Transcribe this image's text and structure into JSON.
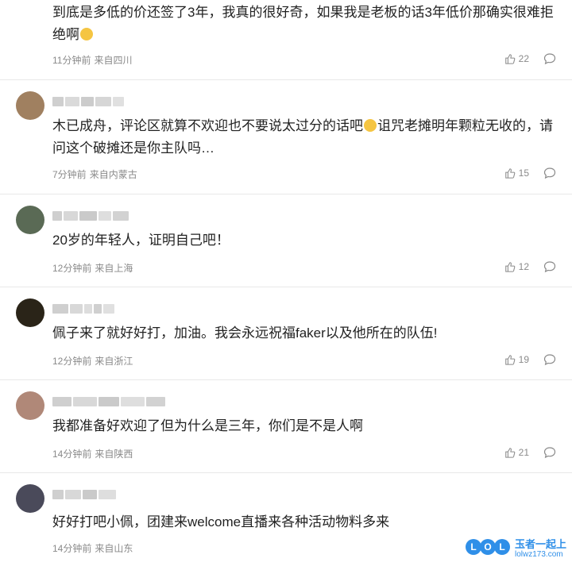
{
  "comments": [
    {
      "text": "到底是多低的价还签了3年，我真的很好奇，如果我是老板的话3年低价那确实很难拒绝啊",
      "emoji": "laugh-cry-emoji",
      "time": "11分钟前",
      "location": "来自四川",
      "likes": "22"
    },
    {
      "text": "木已成舟，评论区就算不欢迎也不要说太过分的话吧",
      "text2": "诅咒老摊明年颗粒无收的，请问这个破摊还是你主队吗…",
      "emoji": "laugh-cry-emoji",
      "time": "7分钟前",
      "location": "来自内蒙古",
      "likes": "15"
    },
    {
      "text": "20岁的年轻人，证明自己吧！",
      "time": "12分钟前",
      "location": "来自上海",
      "likes": "12"
    },
    {
      "text": "佩子来了就好好打，加油。我会永远祝福faker以及他所在的队伍!",
      "time": "12分钟前",
      "location": "来自浙江",
      "likes": "19"
    },
    {
      "text": "我都准备好欢迎了但为什么是三年，你们是不是人啊",
      "time": "14分钟前",
      "location": "来自陕西",
      "likes": "21"
    },
    {
      "text": "好好打吧小佩，团建来welcome直播来各种活动物料多来",
      "time": "14分钟前",
      "location": "来自山东",
      "likes": ""
    }
  ],
  "icons": {
    "like": "thumbs-up-icon",
    "reply": "comment-bubble-icon"
  },
  "watermark": {
    "logo": "LOL",
    "title": "玉者一起上",
    "url": "lolwz173.com"
  },
  "colors": {
    "text": "#222222",
    "meta": "#8a8a8a",
    "divider": "#e8e8e8",
    "watermark": "#2f8fe8"
  }
}
